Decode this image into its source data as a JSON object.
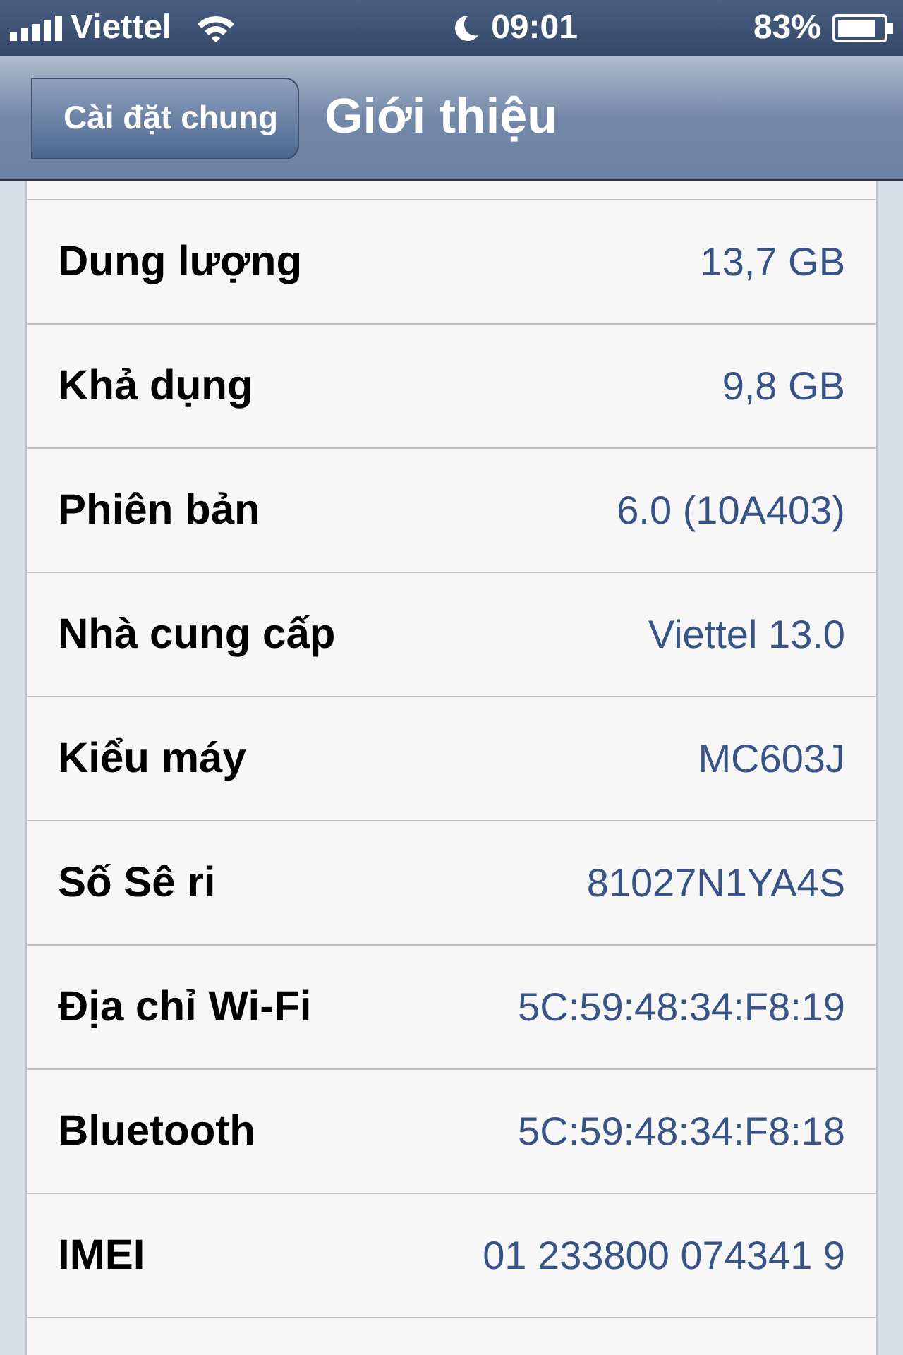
{
  "status_bar": {
    "carrier": "Viettel",
    "time": "09:01",
    "battery": "83%"
  },
  "nav_bar": {
    "back": "Cài đặt chung",
    "title": "Giới thiệu"
  },
  "rows": [
    {
      "label": "Dung lượng",
      "value": "13,7 GB"
    },
    {
      "label": "Khả dụng",
      "value": "9,8 GB"
    },
    {
      "label": "Phiên bản",
      "value": "6.0 (10A403)"
    },
    {
      "label": "Nhà cung cấp",
      "value": "Viettel 13.0"
    },
    {
      "label": "Kiểu máy",
      "value": "MC603J"
    },
    {
      "label": "Số Sê ri",
      "value": "81027N1YA4S"
    },
    {
      "label": "Địa chỉ Wi-Fi",
      "value": "5C:59:48:34:F8:19"
    },
    {
      "label": "Bluetooth",
      "value": "5C:59:48:34:F8:18"
    },
    {
      "label": "IMEI",
      "value": "01 233800 074341 9"
    }
  ]
}
